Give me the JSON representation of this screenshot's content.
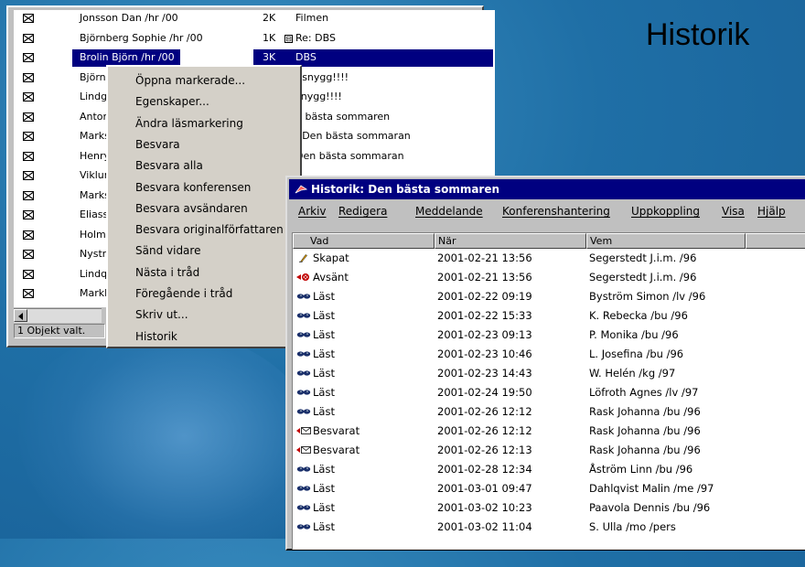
{
  "slide": {
    "title": "Historik"
  },
  "message_list": {
    "rows": [
      {
        "from": "Jonsson Dan /hr /00",
        "size": "2K",
        "subject": "Filmen",
        "selected": false,
        "toggle": ""
      },
      {
        "from": "Björnberg Sophie /hr /00",
        "size": "1K",
        "subject": "Re: DBS",
        "selected": false,
        "toggle": "⊟"
      },
      {
        "from": "Brolin Björn /hr /00",
        "size": "3K",
        "subject": "DBS",
        "selected": true,
        "toggle": ""
      },
      {
        "from": "Björn",
        "size": "",
        "subject": ": snygg!!!!",
        "selected": false,
        "toggle": ""
      },
      {
        "from": "Lindg",
        "size": "",
        "subject": "snygg!!!!",
        "selected": false,
        "toggle": ""
      },
      {
        "from": "Antor",
        "size": "",
        "subject": "n bästa sommaren",
        "selected": false,
        "toggle": ""
      },
      {
        "from": "Marks",
        "size": "",
        "subject": ": Den bästa sommaran",
        "selected": false,
        "toggle": ""
      },
      {
        "from": "Henry",
        "size": "",
        "subject": "Den bästa sommaran",
        "selected": false,
        "toggle": ""
      },
      {
        "from": "Viklur",
        "size": "",
        "subject": "",
        "selected": false,
        "toggle": ""
      },
      {
        "from": "Marks",
        "size": "",
        "subject": "",
        "selected": false,
        "toggle": ""
      },
      {
        "from": "Eliass",
        "size": "",
        "subject": "",
        "selected": false,
        "toggle": ""
      },
      {
        "from": "Holm",
        "size": "",
        "subject": "",
        "selected": false,
        "toggle": ""
      },
      {
        "from": "Nystr",
        "size": "",
        "subject": "",
        "selected": false,
        "toggle": ""
      },
      {
        "from": "Lindq",
        "size": "",
        "subject": "",
        "selected": false,
        "toggle": ""
      },
      {
        "from": "Markl",
        "size": "",
        "subject": "",
        "selected": false,
        "toggle": ""
      }
    ],
    "status": "1 Objekt valt."
  },
  "context_menu": {
    "items": [
      "Öppna markerade...",
      "Egenskaper...",
      "Ändra läsmarkering",
      "Besvara",
      "Besvara alla",
      "Besvara konferensen",
      "Besvara avsändaren",
      "Besvara originalförfattaren",
      "Sänd vidare",
      "Nästa i tråd",
      "Föregående i tråd",
      "Skriv ut...",
      "Historik"
    ]
  },
  "history_window": {
    "title": "Historik: Den bästa sommaren",
    "menu": [
      "Arkiv",
      "Redigera",
      "Meddelande",
      "Konferenshantering",
      "Uppkoppling",
      "Visa",
      "Hjälp"
    ],
    "columns": [
      "Vad",
      "När",
      "Vem"
    ],
    "rows": [
      {
        "icon": "pen-icon",
        "what": "Skapat",
        "when": "2001-02-21 13:56",
        "who": "Segerstedt J.i.m. /96"
      },
      {
        "icon": "sent-icon",
        "what": "Avsänt",
        "when": "2001-02-21 13:56",
        "who": "Segerstedt J.i.m. /96"
      },
      {
        "icon": "eyes-icon",
        "what": "Läst",
        "when": "2001-02-22 09:19",
        "who": "Byström Simon /lv /96"
      },
      {
        "icon": "eyes-icon",
        "what": "Läst",
        "when": "2001-02-22 15:33",
        "who": "K. Rebecka /bu /96"
      },
      {
        "icon": "eyes-icon",
        "what": "Läst",
        "when": "2001-02-23 09:13",
        "who": "P. Monika /bu /96"
      },
      {
        "icon": "eyes-icon",
        "what": "Läst",
        "when": "2001-02-23 10:46",
        "who": "L. Josefina /bu /96"
      },
      {
        "icon": "eyes-icon",
        "what": "Läst",
        "when": "2001-02-23 14:43",
        "who": "W. Helén /kg /97"
      },
      {
        "icon": "eyes-icon",
        "what": "Läst",
        "when": "2001-02-24 19:50",
        "who": "Löfroth Agnes /lv /97"
      },
      {
        "icon": "eyes-icon",
        "what": "Läst",
        "when": "2001-02-26 12:12",
        "who": "Rask Johanna /bu /96"
      },
      {
        "icon": "replied-icon",
        "what": "Besvarat",
        "when": "2001-02-26 12:12",
        "who": "Rask Johanna /bu /96"
      },
      {
        "icon": "replied-icon",
        "what": "Besvarat",
        "when": "2001-02-26 12:13",
        "who": "Rask Johanna /bu /96"
      },
      {
        "icon": "eyes-icon",
        "what": "Läst",
        "when": "2001-02-28 12:34",
        "who": "Åström Linn /bu /96"
      },
      {
        "icon": "eyes-icon",
        "what": "Läst",
        "when": "2001-03-01 09:47",
        "who": "Dahlqvist Malin /me /97"
      },
      {
        "icon": "eyes-icon",
        "what": "Läst",
        "when": "2001-03-02 10:23",
        "who": "Paavola Dennis /bu /96"
      },
      {
        "icon": "eyes-icon",
        "what": "Läst",
        "when": "2001-03-02 11:04",
        "who": "S. Ulla /mo /pers"
      }
    ]
  }
}
